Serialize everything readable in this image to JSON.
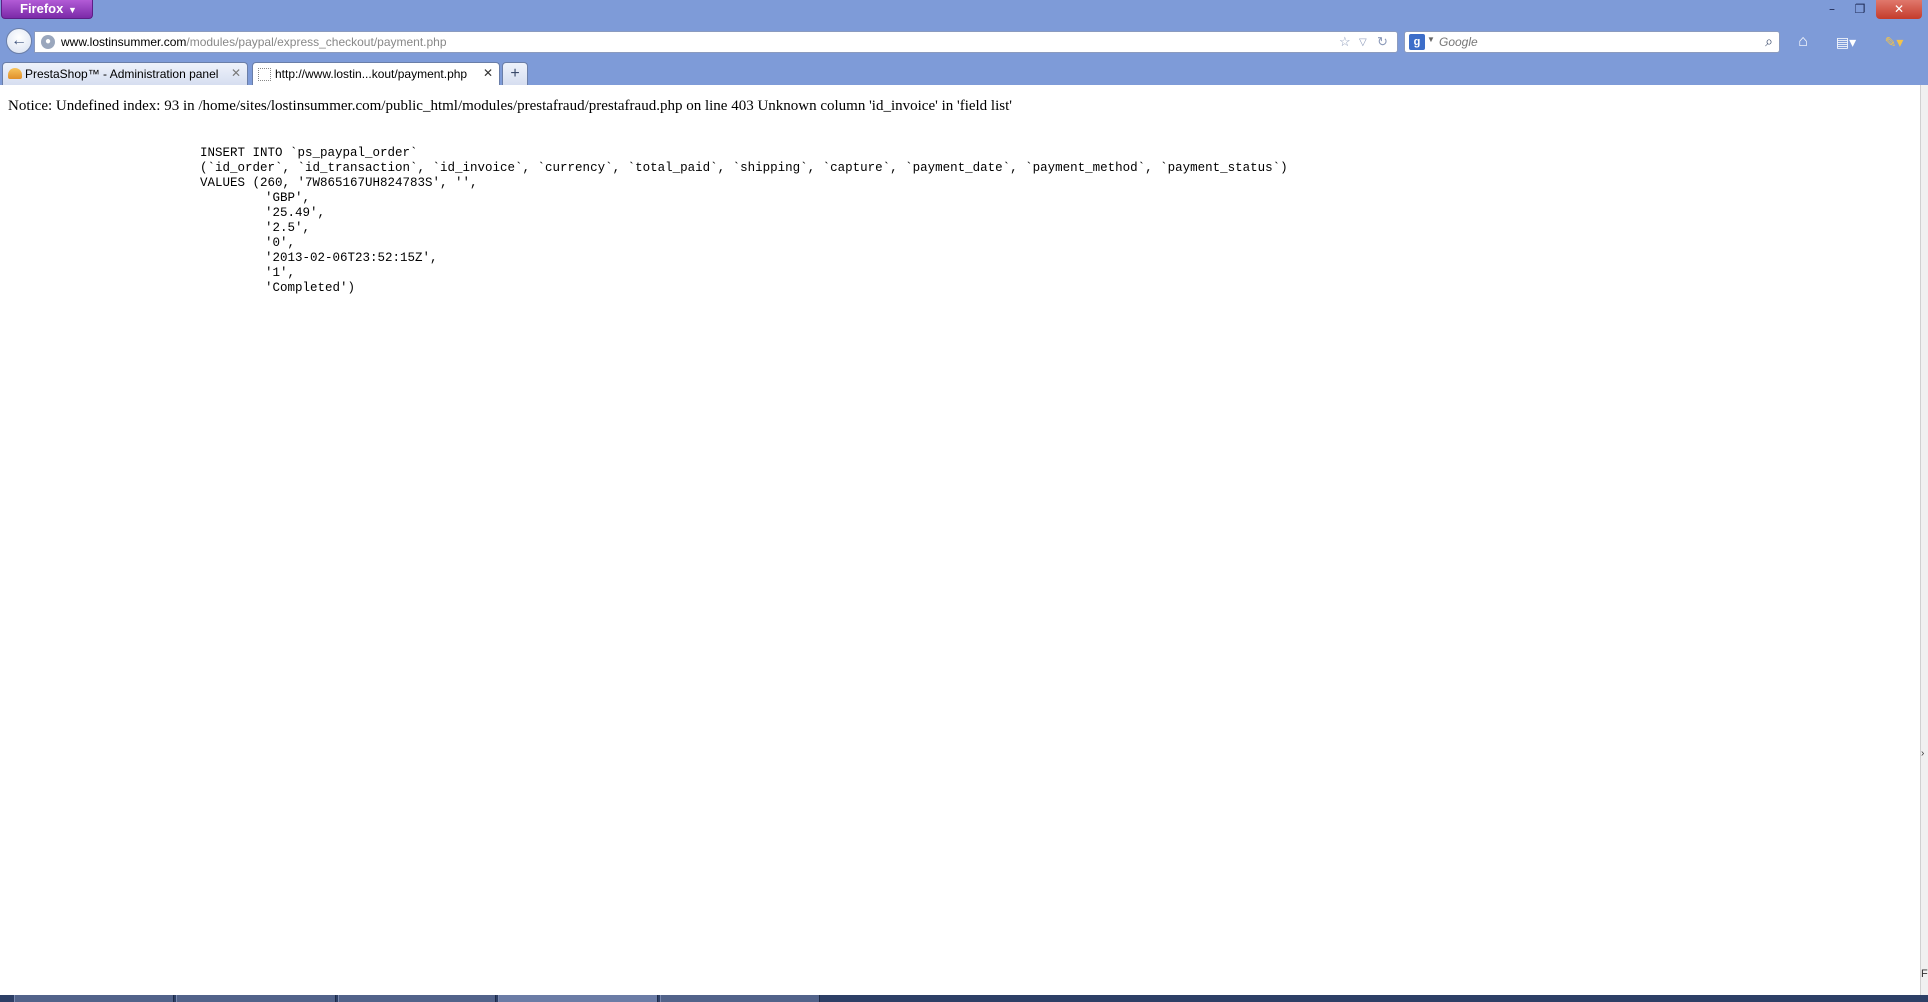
{
  "browser": {
    "menu_button_label": "Firefox",
    "window_controls": {
      "minimize": "–",
      "restore": "❐",
      "close": "✕"
    }
  },
  "navbar": {
    "url_host": "www.lostinsummer.com",
    "url_path": "/modules/paypal/express_checkout/payment.php",
    "search": {
      "engine": "Google",
      "engine_icon_letter": "g",
      "placeholder": "Google"
    }
  },
  "tabs": [
    {
      "label": "PrestaShop™ - Administration panel",
      "active": false
    },
    {
      "label": "http://www.lostin...kout/payment.php",
      "active": true
    }
  ],
  "page": {
    "notice": "Notice: Undefined index: 93 in /home/sites/lostinsummer.com/public_html/modules/prestafraud/prestafraud.php on line 403 Unknown column 'id_invoice' in 'field list'",
    "sql_lines": [
      "INSERT INTO `ps_paypal_order`",
      "(`id_order`, `id_transaction`, `id_invoice`, `currency`, `total_paid`, `shipping`, `capture`, `payment_date`, `payment_method`, `payment_status`)",
      "VALUES (260, '7W865167UH824783S', '',",
      "'GBP',",
      "'25.49',",
      "'2.5',",
      "'0',",
      "'2013-02-06T23:52:15Z',",
      "'1',",
      "'Completed')"
    ]
  },
  "edge_letter": "F",
  "colors": {
    "chrome": "#7e9bd8",
    "firefox_button": "#9b3fc8",
    "close_button": "#c43b2b"
  }
}
